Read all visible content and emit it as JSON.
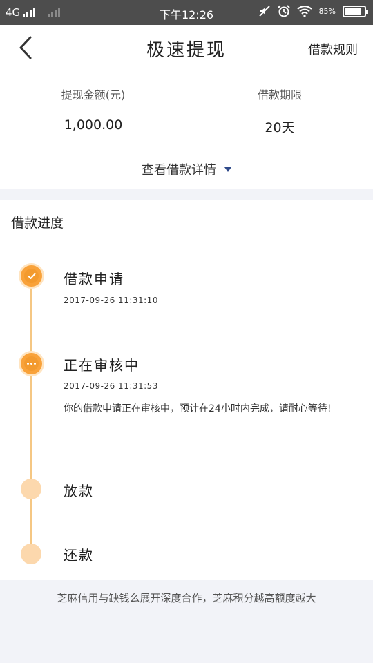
{
  "status_bar": {
    "network": "4G",
    "time": "下午12:26",
    "battery_text": "85%",
    "battery_level": 0.85,
    "icons": [
      "signal-icon",
      "signal-weak-icon",
      "mute-icon",
      "alarm-icon",
      "wifi-icon",
      "battery-icon"
    ]
  },
  "nav": {
    "back_icon": "chevron-left-icon",
    "title": "极速提现",
    "rules_label": "借款规则"
  },
  "summary": {
    "amount_label": "提现金额(元)",
    "amount_value": "1,000.00",
    "term_label": "借款期限",
    "term_value": "20天",
    "details_link": "查看借款详情",
    "details_icon": "caret-down-icon"
  },
  "progress": {
    "title": "借款进度",
    "steps": [
      {
        "title": "借款申请",
        "time": "2017-09-26  11:31:10",
        "status": "done",
        "icon": "check-icon"
      },
      {
        "title": "正在审核中",
        "time": "2017-09-26  11:31:53",
        "status": "active",
        "icon": "ellipsis-icon",
        "description": "你的借款申请正在审核中，预计在24小时内完成，请耐心等待!"
      },
      {
        "title": "放款",
        "status": "pending"
      },
      {
        "title": "还款",
        "status": "pending"
      }
    ]
  },
  "footer": {
    "note": "芝麻信用与缺钱么展开深度合作，芝麻积分越高额度越大"
  },
  "colors": {
    "accent": "#f39a2e",
    "accent_light": "#fcd8ad",
    "track": "#f5c783",
    "status_bar": "#4d4d4d",
    "page_bg": "#f2f3f8",
    "caret": "#2f4a8a"
  }
}
